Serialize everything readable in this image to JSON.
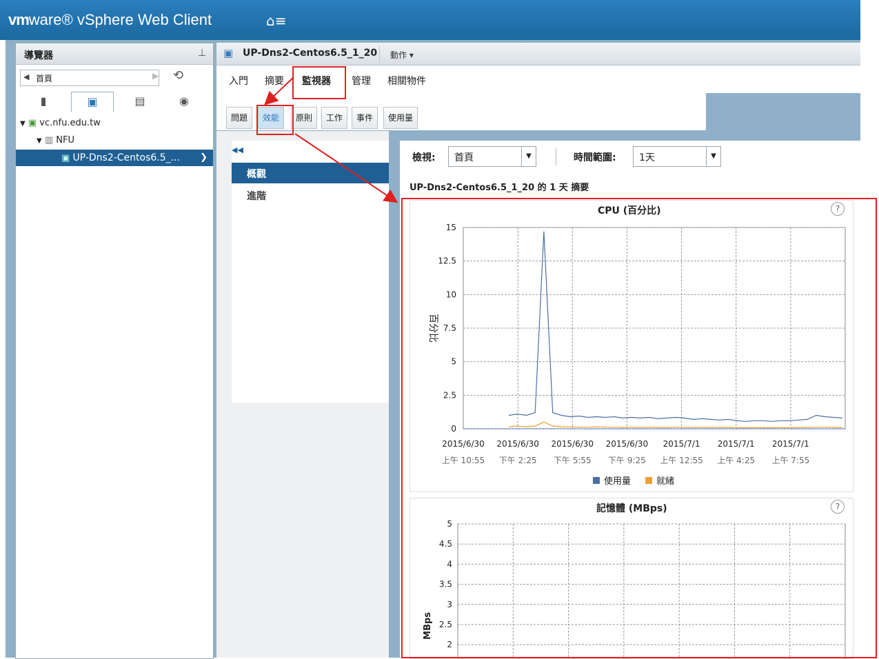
{
  "app": {
    "brand_vm": "vm",
    "brand_ware": "ware",
    "brand_product": "vSphere Web Client",
    "home_icon": "home-menu-icon"
  },
  "navigator": {
    "title": "導覽器",
    "back_label": "首頁",
    "tree": [
      {
        "label": "vc.nfu.edu.tw",
        "icon": "vcenter-icon"
      },
      {
        "label": "NFU",
        "icon": "datacenter-icon"
      },
      {
        "label": "UP-Dns2-Centos6.5_...",
        "icon": "vm-icon"
      }
    ]
  },
  "content": {
    "vm_title": "UP-Dns2-Centos6.5_1_20",
    "actions_label": "動作 ▾",
    "main_tabs": [
      "入門",
      "摘要",
      "監視器",
      "管理",
      "相關物件"
    ],
    "sub_tabs": [
      "問題",
      "效能",
      "原則",
      "工作",
      "事件",
      "使用量"
    ],
    "left_items": [
      "概觀",
      "進階"
    ],
    "view_label": "檢視:",
    "view_value": "首頁",
    "range_label": "時間範圍:",
    "range_value": "1天",
    "summary": "UP-Dns2-Centos6.5_1_20 的 1 天 摘要"
  },
  "chart_data": [
    {
      "type": "line",
      "title": "CPU (百分比)",
      "ylabel": "百分比",
      "ylim": [
        0,
        15
      ],
      "yticks": [
        "0",
        "2.5",
        "5",
        "7.5",
        "10",
        "12.5",
        "15"
      ],
      "x_ticks": [
        {
          "date": "2015/6/30",
          "time": "上午 10:55"
        },
        {
          "date": "2015/6/30",
          "time": "下午 2:25"
        },
        {
          "date": "2015/6/30",
          "time": "下午 5:55"
        },
        {
          "date": "2015/6/30",
          "time": "下午 9:25"
        },
        {
          "date": "2015/7/1",
          "time": "上午 12:55"
        },
        {
          "date": "2015/7/1",
          "time": "上午 4:25"
        },
        {
          "date": "2015/7/1",
          "time": "上午 7:55"
        }
      ],
      "series": [
        {
          "name": "使用量",
          "color": "#4a6fa5",
          "values": [
            1.0,
            1.1,
            1.0,
            1.2,
            14.7,
            1.2,
            1.0,
            0.9,
            0.95,
            0.85,
            0.9,
            0.85,
            0.9,
            0.8,
            0.85,
            0.8,
            0.85,
            0.75,
            0.8,
            0.85,
            0.8,
            0.7,
            0.75,
            0.7,
            0.65,
            0.7,
            0.6,
            0.55,
            0.6,
            0.6,
            0.55,
            0.6,
            0.6,
            0.65,
            0.7,
            1.0,
            0.9,
            0.85,
            0.8
          ]
        },
        {
          "name": "就緒",
          "color": "#f0a030",
          "values": [
            0.15,
            0.2,
            0.15,
            0.2,
            0.5,
            0.2,
            0.15,
            0.15,
            0.12,
            0.12,
            0.15,
            0.12,
            0.12,
            0.1,
            0.12,
            0.1,
            0.12,
            0.1,
            0.1,
            0.12,
            0.1,
            0.1,
            0.1,
            0.1,
            0.1,
            0.1,
            0.08,
            0.08,
            0.08,
            0.08,
            0.08,
            0.08,
            0.08,
            0.1,
            0.1,
            0.12,
            0.12,
            0.1,
            0.1
          ]
        }
      ],
      "grid": true,
      "legend": "bottom"
    },
    {
      "type": "line",
      "title": "記憶體 (MBps)",
      "ylabel": "MBps",
      "yticks": [
        "2",
        "2.5",
        "3",
        "3.5",
        "4",
        "4.5",
        "5"
      ],
      "grid": true,
      "series": []
    }
  ]
}
